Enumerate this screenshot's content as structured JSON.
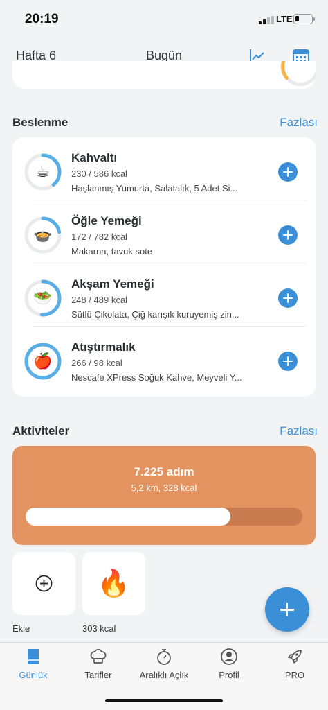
{
  "status_bar": {
    "time": "20:19",
    "network": "LTE"
  },
  "header": {
    "week_label": "Hafta 6",
    "title": "Bugün",
    "chart_icon": "chart-line-icon",
    "calendar_icon": "calendar-icon"
  },
  "nutrition": {
    "title": "Beslenme",
    "more_label": "Fazlası",
    "meals": [
      {
        "name": "Kahvaltı",
        "kcal": "230 / 586 kcal",
        "items": "Haşlanmış Yumurta, Salatalık, 5 Adet Si...",
        "icon": "coffee-cup-icon",
        "emoji": "☕",
        "progress": 0.39
      },
      {
        "name": "Öğle Yemeği",
        "kcal": "172 / 782 kcal",
        "items": "Makarna, tavuk sote",
        "icon": "soup-bowl-icon",
        "emoji": "🍲",
        "progress": 0.22
      },
      {
        "name": "Akşam Yemeği",
        "kcal": "248 / 489 kcal",
        "items": "Sütlü Çikolata, Çiğ karışık kuruyemiş zin...",
        "icon": "salad-icon",
        "emoji": "🥗",
        "progress": 0.51
      },
      {
        "name": "Atıştırmalık",
        "kcal": "266 / 98 kcal",
        "items": "Nescafe XPress Soğuk Kahve, Meyveli Y...",
        "icon": "apple-icon",
        "emoji": "🍎",
        "progress": 1.0
      }
    ]
  },
  "activities": {
    "title": "Aktiviteler",
    "more_label": "Fazlası",
    "steps": {
      "count": "7.225 adım",
      "detail": "5,2 km, 328 kcal",
      "progress": 0.74
    },
    "tiles": [
      {
        "caption": "Ekle",
        "icon": "add-circle-icon"
      },
      {
        "caption": "303 kcal",
        "icon": "flame-icon",
        "emoji": "🔥"
      }
    ]
  },
  "tabs": [
    {
      "label": "Günlük",
      "icon": "book-icon",
      "active": true
    },
    {
      "label": "Tarifler",
      "icon": "chef-hat-icon",
      "active": false
    },
    {
      "label": "Aralıklı Açlık",
      "icon": "stopwatch-icon",
      "active": false
    },
    {
      "label": "Profil",
      "icon": "profile-icon",
      "active": false
    },
    {
      "label": "PRO",
      "icon": "rocket-icon",
      "active": false
    }
  ],
  "colors": {
    "accent": "#3a8fd6",
    "ring_track": "#e9eaec",
    "ring_progress": "#5aaee6",
    "steps_card": "#e2935f",
    "background": "#f2f3f5"
  }
}
